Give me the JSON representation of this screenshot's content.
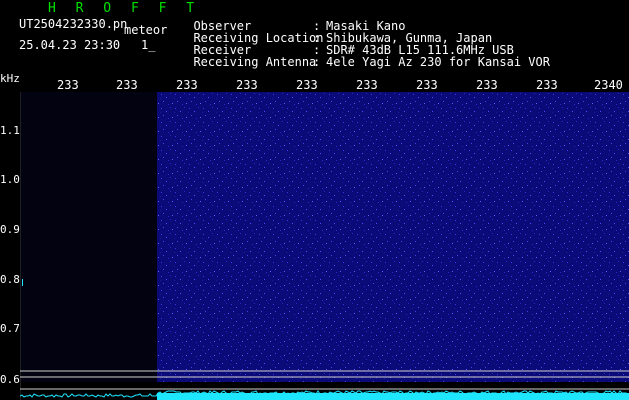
{
  "header": {
    "title": "H R O F F T",
    "file_name": "UT2504232330.pn",
    "meteor_label": "meteor",
    "datetime": "25.04.23 23:30",
    "counter": "1_"
  },
  "info": [
    {
      "label": "Observer",
      "value": "Masaki Kano"
    },
    {
      "label": "Receiving Location",
      "value": "Shibukawa, Gunma, Japan"
    },
    {
      "label": "Receiver",
      "value": "SDR# 43dB L15 111.6MHz USB"
    },
    {
      "label": "Receiving Antenna",
      "value": "4ele Yagi Az 230 for Kansai VOR"
    }
  ],
  "axis": {
    "y_unit": "kHz",
    "x_ticks": [
      "233",
      "233",
      "233",
      "233",
      "233",
      "233",
      "233",
      "233",
      "233",
      "2340"
    ],
    "y_ticks": [
      "1.1",
      "1.0",
      "0.9",
      "0.8",
      "0.7",
      "0.6"
    ]
  },
  "colors": {
    "background": "#000000",
    "waterfall": "#0c0c8c",
    "trace": "#1ee6ff",
    "title": "#00e000"
  }
}
